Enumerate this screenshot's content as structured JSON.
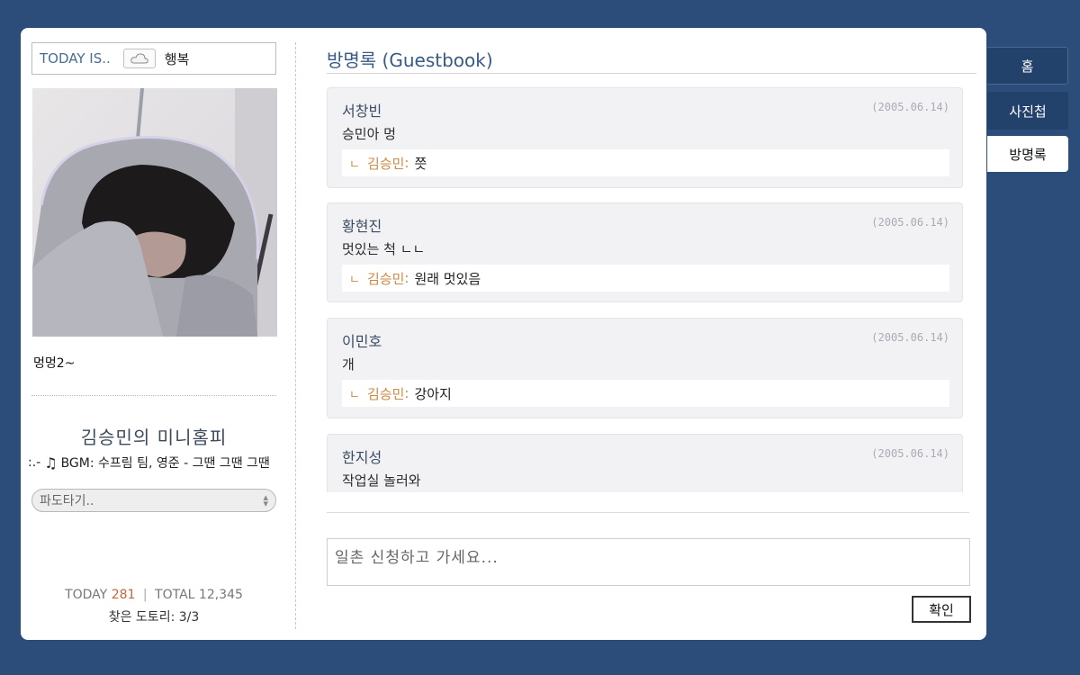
{
  "today": {
    "label": "TODAY IS..",
    "mood_icon": "cloud-icon",
    "mood": "행복"
  },
  "profile": {
    "caption": "멍멍2~",
    "site_title": "김승민의 미니홈피",
    "bgm_prefix": ":.-",
    "bgm_icon": "music-note-icon",
    "bgm": "BGM: 수프림 팀, 영준 - 그땐 그땐 그땐"
  },
  "wave": {
    "placeholder": "파도타기.."
  },
  "stats": {
    "today_label": "TODAY",
    "today_count": "281",
    "divider": "|",
    "total_label": "TOTAL",
    "total_count": "12,345",
    "acorns": "찾은 도토리: 3/3"
  },
  "guestbook": {
    "title": "방명록 (Guestbook)",
    "entries": [
      {
        "author": "서창빈",
        "date": "(2005.06.14)",
        "message": "승민아 멍",
        "reply_author": "김승민",
        "reply": "쯧"
      },
      {
        "author": "황현진",
        "date": "(2005.06.14)",
        "message": "멋있는 척 ㄴㄴ",
        "reply_author": "김승민",
        "reply": "원래 멋있음"
      },
      {
        "author": "이민호",
        "date": "(2005.06.14)",
        "message": "개",
        "reply_author": "김승민",
        "reply": "강아지"
      },
      {
        "author": "한지성",
        "date": "(2005.06.14)",
        "message": "작업실 놀러와"
      }
    ],
    "reply_mark": "ㄴ",
    "input_placeholder": "일촌 신청하고 가세요...",
    "confirm_label": "확인"
  },
  "tabs": {
    "home": "홈",
    "photos": "사진첩",
    "guestbook": "방명록"
  },
  "colors": {
    "background": "#2c4c7a",
    "tab_bg": "#23426b",
    "accent_title": "#375a86",
    "reply_accent": "#cc8a45"
  }
}
